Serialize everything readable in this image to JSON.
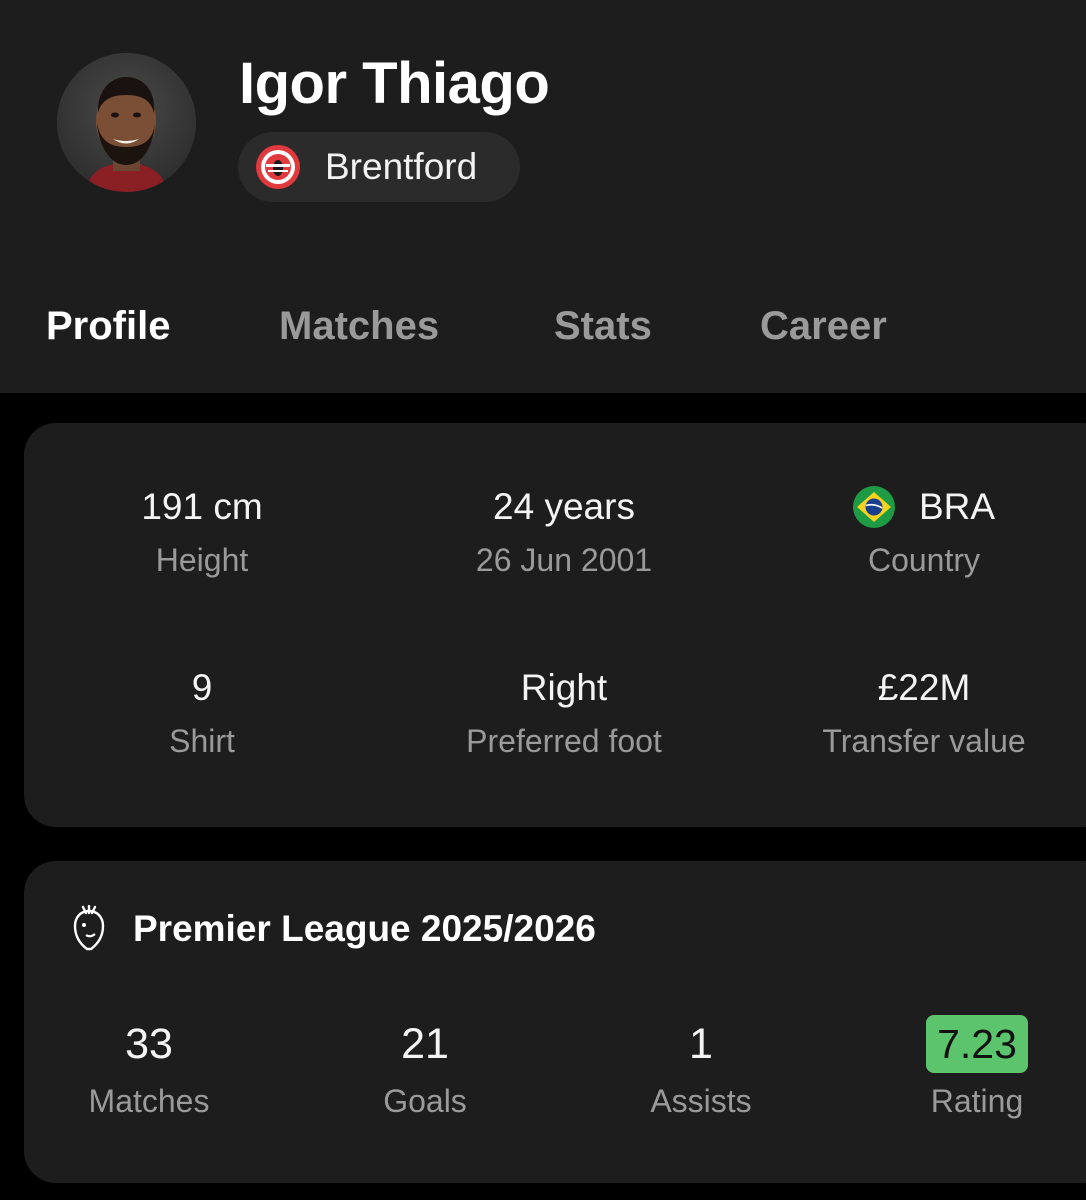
{
  "player": {
    "name": "Igor Thiago",
    "team": "Brentford"
  },
  "tabs": [
    {
      "label": "Profile",
      "active": true
    },
    {
      "label": "Matches",
      "active": false
    },
    {
      "label": "Stats",
      "active": false
    },
    {
      "label": "Career",
      "active": false
    }
  ],
  "info": {
    "height": {
      "value": "191 cm",
      "label": "Height"
    },
    "age": {
      "value": "24 years",
      "label": "26 Jun 2001"
    },
    "country": {
      "value": "BRA",
      "label": "Country",
      "flag_icon": "brazil-flag-icon"
    },
    "shirt": {
      "value": "9",
      "label": "Shirt"
    },
    "foot": {
      "value": "Right",
      "label": "Preferred foot"
    },
    "transfer": {
      "value": "£22M",
      "label": "Transfer value"
    }
  },
  "league": {
    "title": "Premier League 2025/2026",
    "icon": "premier-league-lion-icon",
    "stats": [
      {
        "value": "33",
        "label": "Matches"
      },
      {
        "value": "21",
        "label": "Goals"
      },
      {
        "value": "1",
        "label": "Assists"
      },
      {
        "value": "7.23",
        "label": "Rating"
      }
    ]
  },
  "colors": {
    "background": "#000000",
    "surface": "#1d1d1d",
    "chip": "#2b2b2b",
    "text_primary": "#ffffff",
    "text_secondary": "#9a9a9a",
    "rating_badge": "#5cc46c",
    "brentford_red": "#e03a3e"
  }
}
